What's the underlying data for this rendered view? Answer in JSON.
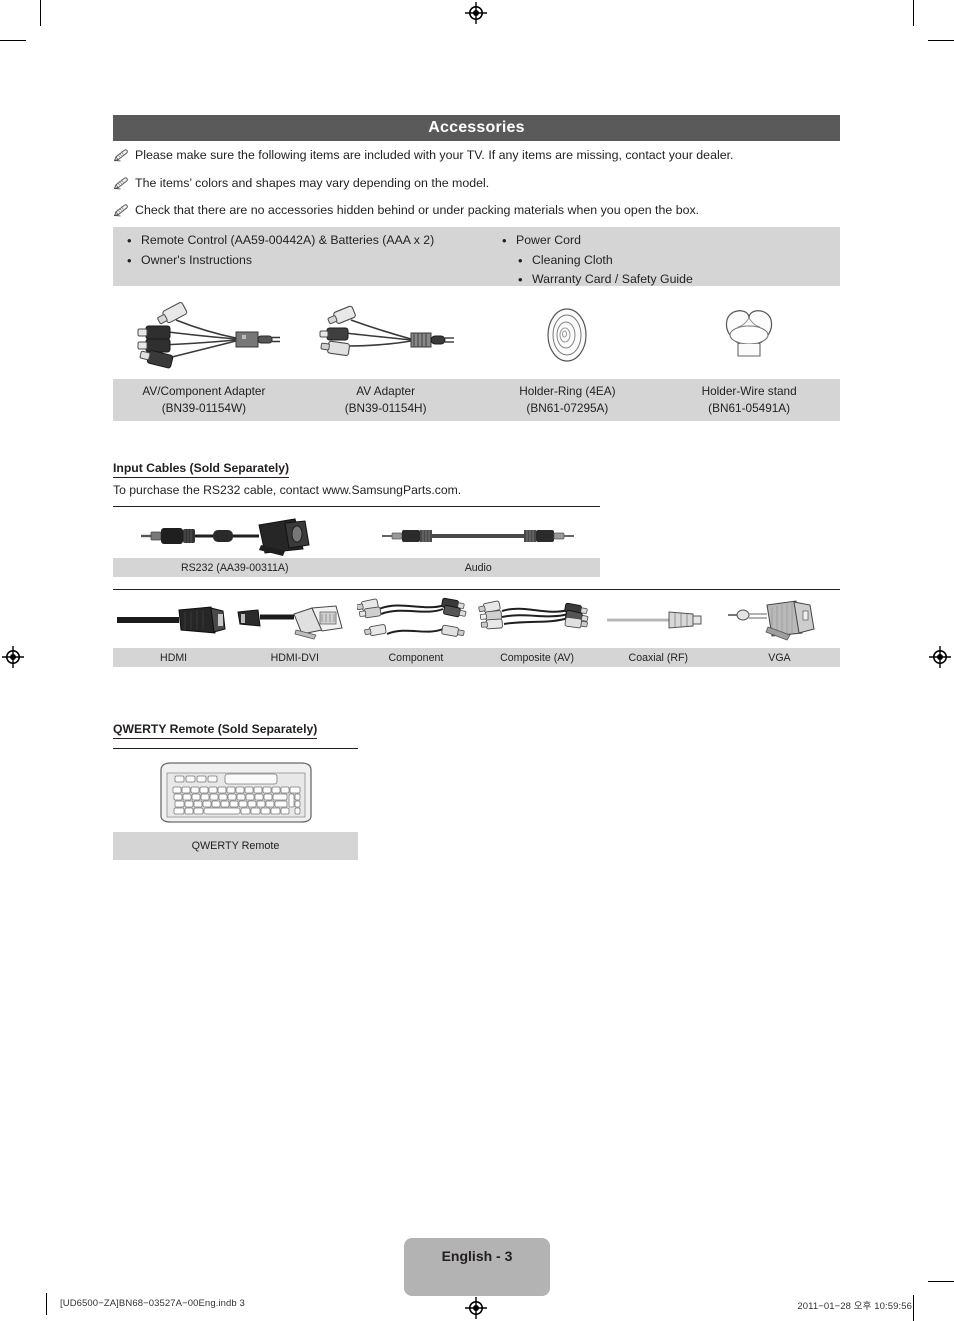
{
  "section": {
    "title": "Accessories"
  },
  "notes": [
    {
      "icon": "pencil-note-icon",
      "text": "Please make sure the following items are included with your TV. If any items are missing, contact your dealer."
    },
    {
      "icon": "pencil-note-icon",
      "text": "The items’ colors and shapes may vary depending on the model."
    },
    {
      "icon": "pencil-note-icon",
      "text": "Check that there are no accessories hidden behind or under packing materials when you open the box."
    }
  ],
  "included_items": {
    "bullet": "•",
    "left_column": [
      "Remote Control (AA59-00442A) & Batteries (AAA x 2)",
      "Owner's Instructions"
    ],
    "right_column": [
      "Power Cord",
      "Cleaning Cloth",
      "Warranty Card / Safety Guide"
    ]
  },
  "accessories": [
    {
      "icon": "av-component-adapter-icon",
      "name": "AV/Component Adapter",
      "part": "(BN39-01154W)"
    },
    {
      "icon": "av-adapter-icon",
      "name": "AV Adapter",
      "part": "(BN39-01154H)"
    },
    {
      "icon": "holder-ring-icon",
      "name": "Holder-Ring (4EA)",
      "part": "(BN61-07295A)"
    },
    {
      "icon": "holder-wire-stand-icon",
      "name": "Holder-Wire stand",
      "part": "(BN61-05491A)"
    }
  ],
  "input_cables": {
    "heading": "Input Cables (Sold Separately)",
    "note": "To purchase the RS232 cable, contact www.SamsungParts.com.",
    "row1": [
      {
        "icon": "rs232-cable-icon",
        "label": "RS232 (AA39-00311A)"
      },
      {
        "icon": "audio-cable-icon",
        "label": "Audio"
      }
    ],
    "row2": [
      {
        "icon": "hdmi-cable-icon",
        "label": "HDMI"
      },
      {
        "icon": "hdmi-dvi-cable-icon",
        "label": "HDMI-DVI"
      },
      {
        "icon": "component-cable-icon",
        "label": "Component"
      },
      {
        "icon": "composite-cable-icon",
        "label": "Composite (AV)"
      },
      {
        "icon": "coaxial-cable-icon",
        "label": "Coaxial (RF)"
      },
      {
        "icon": "vga-cable-icon",
        "label": "VGA"
      }
    ]
  },
  "qwerty": {
    "heading": "QWERTY Remote (Sold Separately)",
    "items": [
      {
        "icon": "qwerty-remote-icon",
        "label": "QWERTY Remote"
      }
    ]
  },
  "footer": {
    "page_badge": "English - 3",
    "file_info": "[UD6500−ZA]BN68−03527A−00Eng.indb   3",
    "timestamp": "2011−01−28   오후 10:59:56"
  },
  "colors": {
    "section_bar": "#5b5a5a",
    "panel_gray": "#d5d5d5",
    "badge_gray": "#b3b3b3",
    "text": "#231f20"
  }
}
